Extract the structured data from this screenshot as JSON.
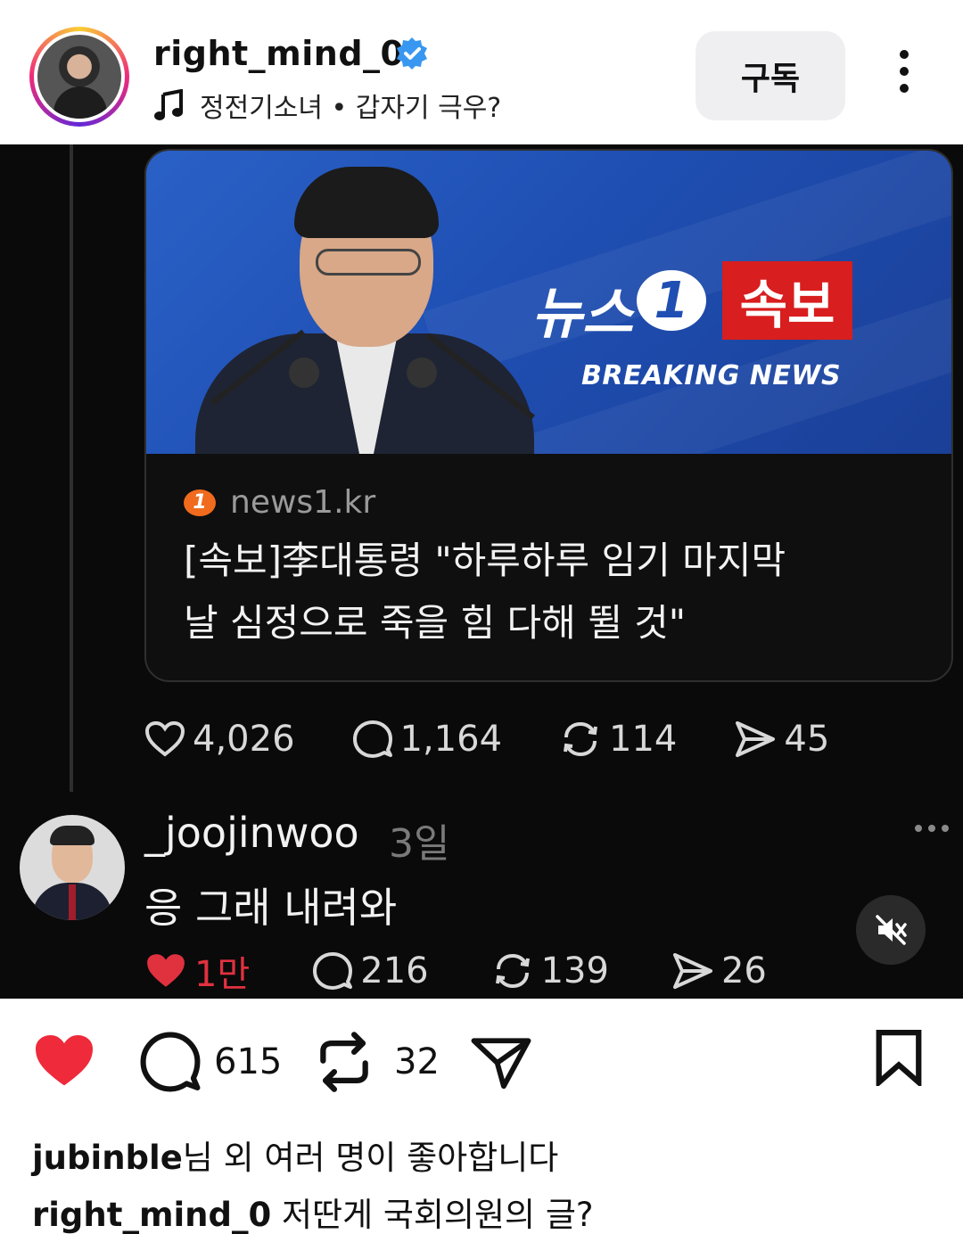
{
  "header": {
    "username": "right_mind_0",
    "music_title": "정전기소녀 • 갑자기 극우?",
    "subscribe_label": "구독"
  },
  "post": {
    "news_card": {
      "brand_text": "뉴스",
      "brand_number": "1",
      "flash_label": "속보",
      "breaking_label": "BREAKING NEWS",
      "source": "news1.kr",
      "headline_line1": "[속보]李대통령 \"하루하루 임기 마지막",
      "headline_line2": "날 심정으로 죽을 힘 다해 뛸 것\""
    },
    "stats": {
      "likes": "4,026",
      "comments": "1,164",
      "reposts": "114",
      "shares": "45"
    },
    "reply": {
      "username": "_joojinwoo",
      "time": "3일",
      "text": "응 그래 내려와",
      "likes": "1만",
      "comments": "216",
      "reposts": "139",
      "shares": "26"
    }
  },
  "actions": {
    "comment_count": "615",
    "repost_count": "32"
  },
  "likes_summary": {
    "user": "jubinble",
    "suffix": "님 외 여러 명이 좋아합니다"
  },
  "caption": {
    "user": "right_mind_0",
    "text": "저딴게 국회의원의 글?"
  },
  "colors": {
    "like_red": "#ee2a3b",
    "verified_blue": "#3897f0",
    "flash_red": "#d81e1e",
    "news_blue": "#1f4fb3"
  }
}
